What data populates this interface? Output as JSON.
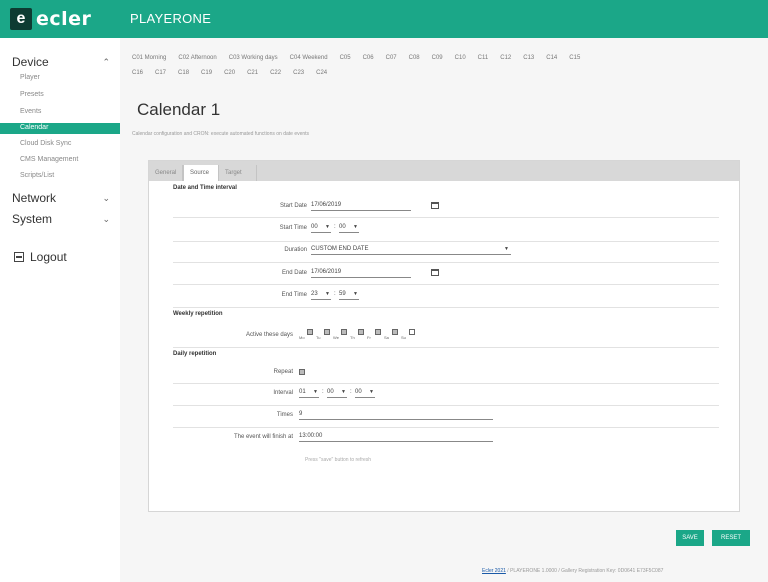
{
  "header": {
    "logo_mark": "e",
    "logo_text": "ecler",
    "product": "PLAYERONE"
  },
  "sidebar": {
    "device": "Device",
    "device_items": [
      "Player",
      "Presets",
      "Events",
      "Calendar",
      "Cloud Disk Sync",
      "CMS Management",
      "Scripts/List"
    ],
    "active_item": "Calendar",
    "network": "Network",
    "system": "System",
    "logout": "Logout"
  },
  "calendar_tabs": {
    "row1": [
      "C01 Morning",
      "C02 Afternoon",
      "C03 Working days",
      "C04 Weekend",
      "C05",
      "C06",
      "C07",
      "C08",
      "C09",
      "C10",
      "C11",
      "C12",
      "C13",
      "C14",
      "C15"
    ],
    "row2": [
      "C16",
      "C17",
      "C18",
      "C19",
      "C20",
      "C21",
      "C22",
      "C23",
      "C24"
    ]
  },
  "page": {
    "title": "Calendar 1",
    "description": "Calendar configuration and CRON: execute automated functions on date events"
  },
  "panel_tabs": {
    "general": "General",
    "source": "Source",
    "target": "Target"
  },
  "form": {
    "date_time_heading": "Date and Time interval",
    "start_date_label": "Start Date",
    "start_date": "17/06/2019",
    "start_time_label": "Start Time",
    "start_hour": "00",
    "start_min": "00",
    "duration_label": "Duration",
    "duration": "CUSTOM END DATE",
    "end_date_label": "End Date",
    "end_date": "17/06/2019",
    "end_time_label": "End Time",
    "end_hour": "23",
    "end_min": "59",
    "weekly_heading": "Weekly repetition",
    "active_days_label": "Active these days",
    "days": [
      "Mo",
      "Tu",
      "We",
      "Th",
      "Fr",
      "Sa",
      "Su"
    ],
    "days_checked": [
      true,
      true,
      true,
      true,
      true,
      true,
      false
    ],
    "daily_heading": "Daily repetition",
    "repeat_label": "Repeat",
    "interval_label": "Interval",
    "interval_h": "01",
    "interval_m": "00",
    "interval_s": "00",
    "times_label": "Times",
    "times": "9",
    "finish_label": "The event will finish at",
    "finish_time": "13:00:00",
    "save_note": "Press \"save\" button to refresh"
  },
  "buttons": {
    "save": "SAVE",
    "reset": "RESET"
  },
  "footer": {
    "link": "Ecler 2021",
    "text": " / PLAYERONE 1.0000 / Gallery Registration Key: 0D0641 E73F5C087"
  },
  "colors": {
    "brand": "#1ba788",
    "dark": "#0d3b32"
  }
}
